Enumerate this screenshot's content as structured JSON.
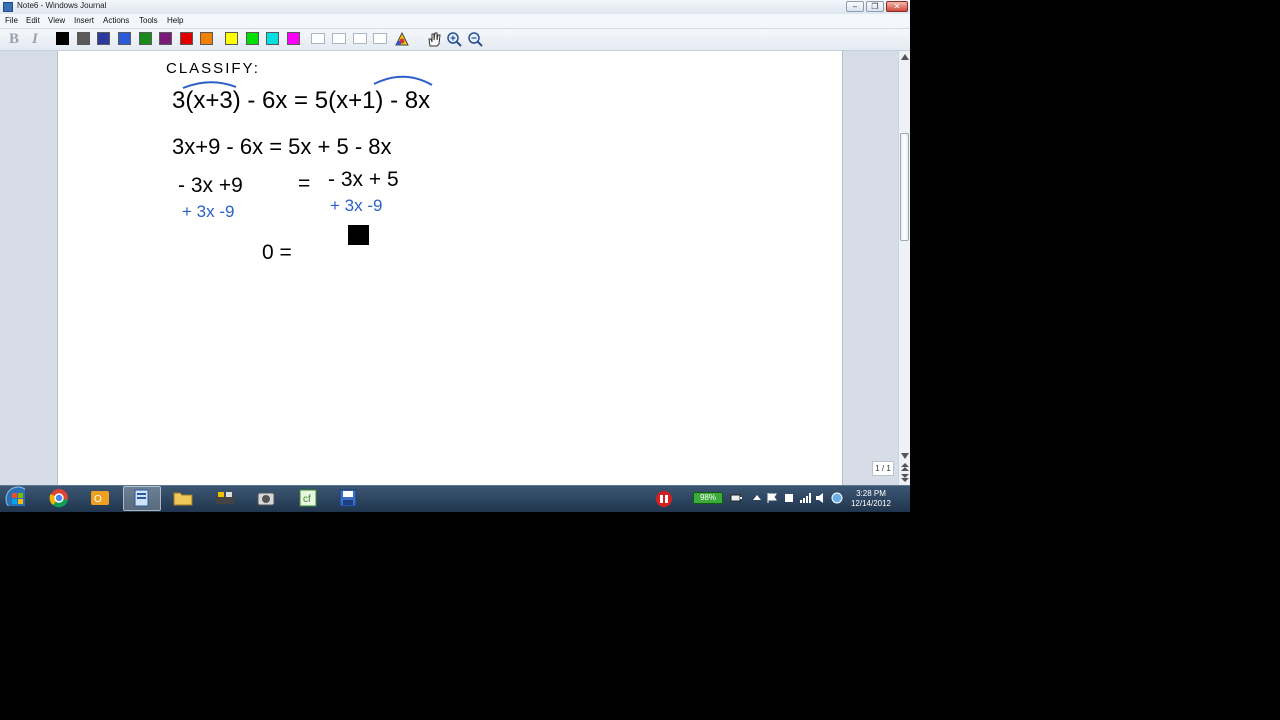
{
  "window": {
    "title": "Note6 - Windows Journal",
    "minimize_glyph": "–",
    "restore_glyph": "❐",
    "close_glyph": "✕"
  },
  "menu": {
    "items": [
      "File",
      "Edit",
      "View",
      "Insert",
      "Actions",
      "Tools",
      "Help"
    ]
  },
  "toolbar": {
    "bold_label": "B",
    "italic_label": "I",
    "pen_colors": [
      "#000000",
      "#5a5a5a",
      "#2a3aa0",
      "#2a5ad8",
      "#1a8a1a",
      "#7a1a7a",
      "#e00000",
      "#f08000",
      "#ffff00",
      "#00e000",
      "#00e0e0",
      "#ff00ff"
    ],
    "icons": [
      "bold-icon",
      "italic-icon",
      "pen-style-box-1",
      "pen-style-box-2",
      "pen-style-box-3",
      "pen-style-box-4",
      "highlighter-icon",
      "hand-pan-icon",
      "zoom-in-icon",
      "zoom-out-icon"
    ]
  },
  "note": {
    "line1": "CLASSIFY:",
    "line2": "3(x+3) - 6x = 5(x+1) - 8x",
    "line3": "3x+9 - 6x = 5x + 5 - 8x",
    "line4_left": "- 3x +9",
    "line4_eq": "=",
    "line4_right": "- 3x + 5",
    "line5_left": "+ 3x  -9",
    "line5_right": "+ 3x  -9",
    "line6": "0 =",
    "ink_color": "#000000",
    "annotation_color": "#2b5fc7"
  },
  "status": {
    "page_counter": "1 / 1"
  },
  "taskbar": {
    "battery_label": "98%",
    "clock_time": "3:28 PM",
    "clock_date": "12/14/2012",
    "icons": [
      "start-orb-icon",
      "chrome-icon",
      "outlook-icon",
      "windows-journal-icon",
      "explorer-folder-icon",
      "snipping-tool-icon",
      "camera-icon",
      "app-icon",
      "save-disk-icon"
    ]
  }
}
